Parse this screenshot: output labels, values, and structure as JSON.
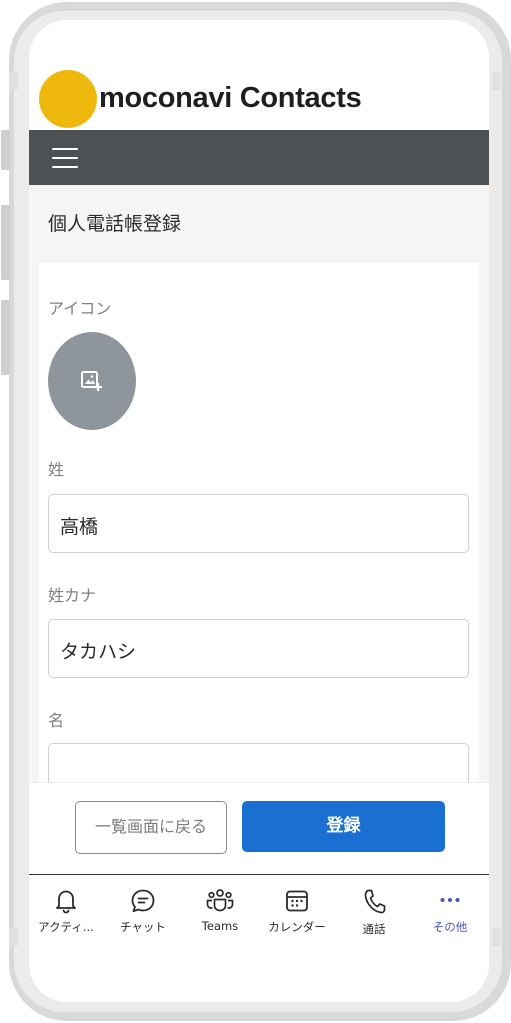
{
  "app": {
    "title": "moconavi Contacts",
    "logo_color": "#eeb80c"
  },
  "navbar": {
    "menu_icon": "hamburger-menu-icon",
    "background": "#4c5153"
  },
  "page": {
    "title": "個人電話帳登録"
  },
  "form": {
    "icon_label": "アイコン",
    "icon_button_icon": "add-image-icon",
    "last_name": {
      "label": "姓",
      "value": "高橋"
    },
    "last_name_kana": {
      "label": "姓カナ",
      "value": "タカハシ"
    },
    "first_name": {
      "label": "名",
      "value": ""
    }
  },
  "actions": {
    "back_label": "一覧画面に戻る",
    "submit_label": "登録",
    "submit_color": "#1a6fd3"
  },
  "tabbar": {
    "active_color": "#4b53bc",
    "items": [
      {
        "label": "アクティ...",
        "icon": "bell-icon"
      },
      {
        "label": "チャット",
        "icon": "chat-icon"
      },
      {
        "label": "Teams",
        "icon": "teams-icon"
      },
      {
        "label": "カレンダー",
        "icon": "calendar-icon"
      },
      {
        "label": "通話",
        "icon": "phone-icon"
      },
      {
        "label": "その他",
        "icon": "more-icon"
      }
    ],
    "active_index": 5
  }
}
